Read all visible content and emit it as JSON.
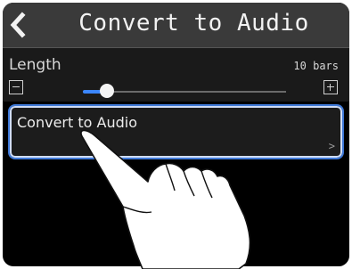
{
  "header": {
    "title": "Convert to Audio",
    "back_icon": "chevron-left-icon"
  },
  "length": {
    "label": "Length",
    "value": "10 bars",
    "slider_level": 0.12,
    "minus_icon": "minus-icon",
    "plus_icon": "plus-icon"
  },
  "menu": {
    "convert_label": "Convert to Audio",
    "chevron": ">"
  },
  "overlay": {
    "hand_icon": "pointing-hand-icon"
  },
  "colors": {
    "accent": "#3b86ff",
    "header_bg": "#3a3a3a",
    "selection_border": "#3f79d8"
  }
}
